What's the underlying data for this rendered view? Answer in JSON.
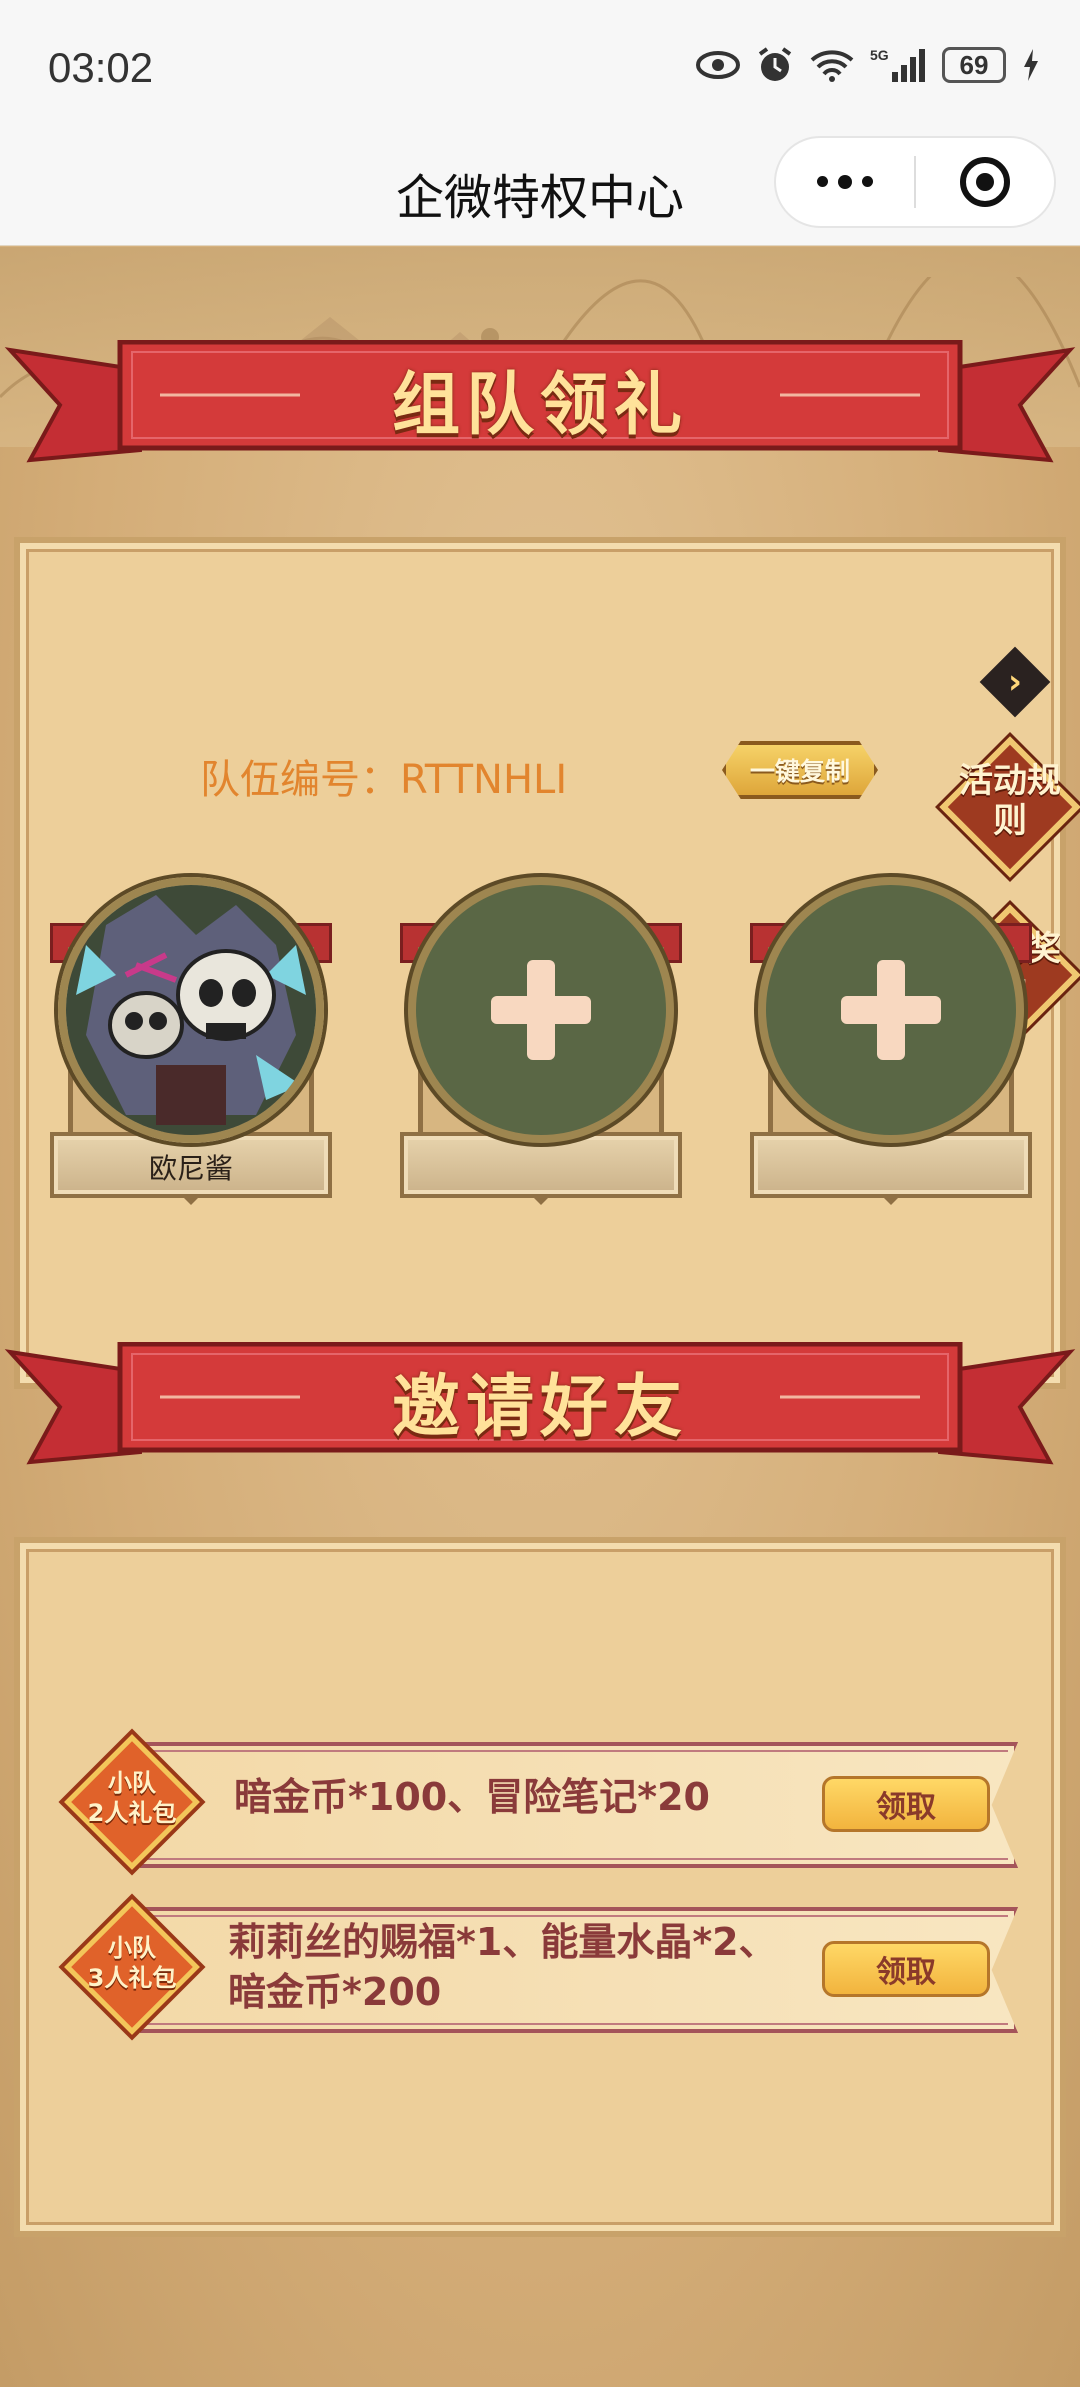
{
  "status_bar": {
    "time": "03:02",
    "battery": "69",
    "icons": [
      "eye-icon",
      "alarm-icon",
      "wifi-icon",
      "5g-signal-icon",
      "charging-icon"
    ]
  },
  "navbar": {
    "title": "企微特权中心",
    "icons": [
      "more-icon",
      "target-icon"
    ]
  },
  "team_section": {
    "title": "组队领礼",
    "team_label": "队伍编号：RTTNHLI",
    "copy_button": "一键复制",
    "rules_label": "活动规则",
    "rewards_label": "我的奖励",
    "slots": [
      {
        "name": "欧尼酱",
        "filled": true
      },
      {
        "name": "",
        "filled": false
      },
      {
        "name": "",
        "filled": false
      }
    ]
  },
  "invite_section": {
    "title": "邀请好友",
    "rewards": [
      {
        "badge_line1": "小队",
        "badge_line2": "2人礼包",
        "text_line1": "暗金币*100、冒险笔记*20",
        "text_line2": "",
        "button": "领取"
      },
      {
        "badge_line1": "小队",
        "badge_line2": "3人礼包",
        "text_line1": "莉莉丝的赐福*1、能量水晶*2、",
        "text_line2": "暗金币*200",
        "button": "领取"
      }
    ]
  },
  "colors": {
    "accent_red": "#c8323a",
    "gold": "#f2c25a",
    "parchment": "#edcf9a",
    "team_text": "#e2852e"
  }
}
